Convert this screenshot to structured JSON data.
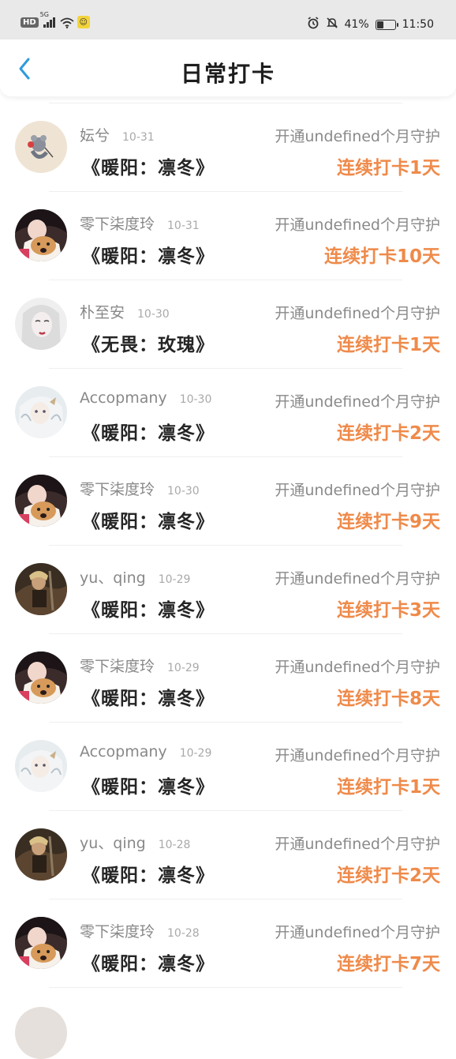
{
  "status_bar": {
    "hd": "HD",
    "network": "5G",
    "battery_percent": "41%",
    "battery_level": 0.41,
    "time": "11:50",
    "icons": [
      "signal-icon",
      "wifi-icon",
      "app-notification-icon",
      "alarm-icon",
      "mute-icon",
      "battery-icon"
    ]
  },
  "header": {
    "back_icon": "chevron-left-icon",
    "title": "日常打卡",
    "accent_color": "#2e9bdc"
  },
  "colors": {
    "streak": "#ef8a4a",
    "username": "#888888",
    "title": "#252525"
  },
  "checkins": [
    {
      "username": "妘兮",
      "date": "10-31",
      "guard": "开通undefined个月守护",
      "book": "《暖阳：凛冬》",
      "streak": "连续打卡1天",
      "avatar": "mouse-illustration"
    },
    {
      "username": "零下柒度玲",
      "date": "10-31",
      "guard": "开通undefined个月守护",
      "book": "《暖阳：凛冬》",
      "streak": "连续打卡10天",
      "avatar": "girl-with-dog"
    },
    {
      "username": "朴至安",
      "date": "10-30",
      "guard": "开通undefined个月守护",
      "book": "《无畏：玫瑰》",
      "streak": "连续打卡1天",
      "avatar": "pale-girl"
    },
    {
      "username": "Accopmany",
      "date": "10-30",
      "guard": "开通undefined个月守护",
      "book": "《暖阳：凛冬》",
      "streak": "连续打卡2天",
      "avatar": "white-hair-anime"
    },
    {
      "username": "零下柒度玲",
      "date": "10-30",
      "guard": "开通undefined个月守护",
      "book": "《暖阳：凛冬》",
      "streak": "连续打卡9天",
      "avatar": "girl-with-dog"
    },
    {
      "username": "yu、qing",
      "date": "10-29",
      "guard": "开通undefined个月守护",
      "book": "《暖阳：凛冬》",
      "streak": "连续打卡3天",
      "avatar": "dark-warrior"
    },
    {
      "username": "零下柒度玲",
      "date": "10-29",
      "guard": "开通undefined个月守护",
      "book": "《暖阳：凛冬》",
      "streak": "连续打卡8天",
      "avatar": "girl-with-dog"
    },
    {
      "username": "Accopmany",
      "date": "10-29",
      "guard": "开通undefined个月守护",
      "book": "《暖阳：凛冬》",
      "streak": "连续打卡1天",
      "avatar": "white-hair-anime"
    },
    {
      "username": "yu、qing",
      "date": "10-28",
      "guard": "开通undefined个月守护",
      "book": "《暖阳：凛冬》",
      "streak": "连续打卡2天",
      "avatar": "dark-warrior"
    },
    {
      "username": "零下柒度玲",
      "date": "10-28",
      "guard": "开通undefined个月守护",
      "book": "《暖阳：凛冬》",
      "streak": "连续打卡7天",
      "avatar": "girl-with-dog"
    }
  ]
}
